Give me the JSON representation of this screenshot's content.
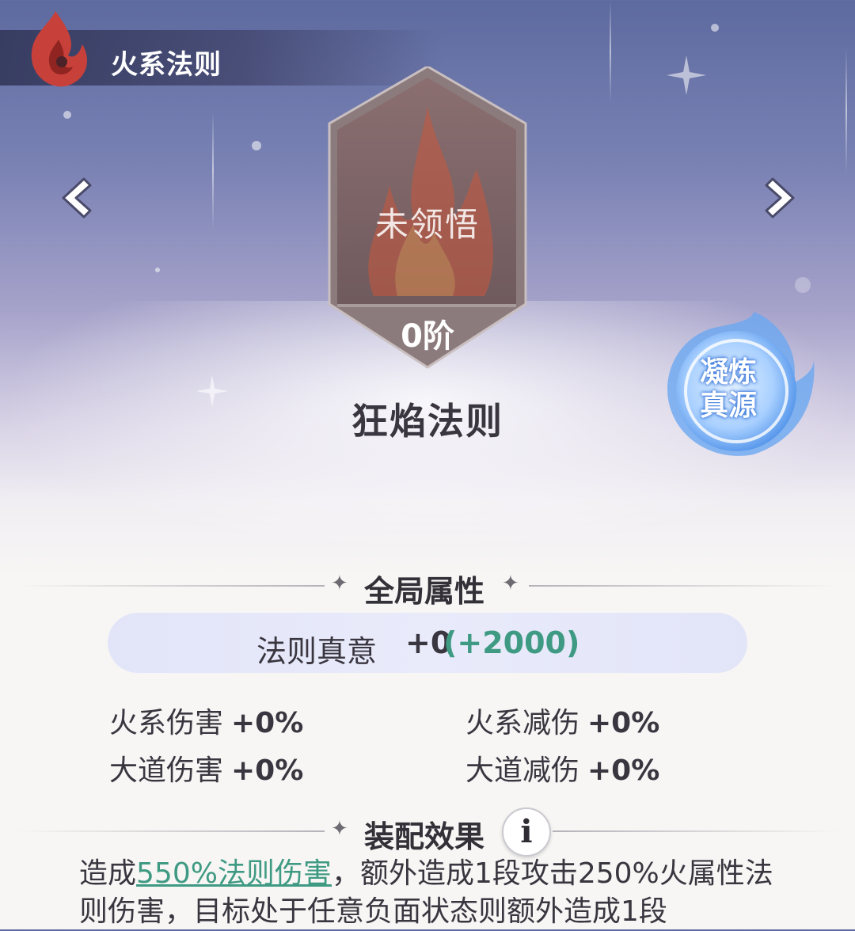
{
  "header": {
    "title": "火系法则",
    "icon": "fire-swirl-icon"
  },
  "nav": {
    "prev_icon": "chevron-left-icon",
    "next_icon": "chevron-right-icon"
  },
  "emblem": {
    "status": "未领悟",
    "rank": "0阶",
    "icon": "flame-emblem"
  },
  "law_name": "狂焰法则",
  "condense_button": {
    "label_line1": "凝炼",
    "label_line2": "真源"
  },
  "global_attributes": {
    "title": "全局属性",
    "main_stat": {
      "label": "法则真意",
      "base": "+0",
      "bonus": "(+2000)"
    },
    "stats": [
      {
        "label": "火系伤害",
        "value": "+0%"
      },
      {
        "label": "火系减伤",
        "value": "+0%"
      },
      {
        "label": "大道伤害",
        "value": "+0%"
      },
      {
        "label": "大道减伤",
        "value": "+0%"
      }
    ]
  },
  "equip_effect": {
    "title": "装配效果",
    "info_icon": "info-icon",
    "desc_prefix": "造成",
    "desc_highlight": "550%法则伤害",
    "desc_rest_line1": "，额外造成1段攻击250%火属性法",
    "desc_line2": "则伤害，目标处于任意负面状态则额外造成1段"
  },
  "colors": {
    "accent_green": "#3f9a83",
    "fire_red": "#c8403a",
    "water_blue": "#4a8ee8"
  }
}
